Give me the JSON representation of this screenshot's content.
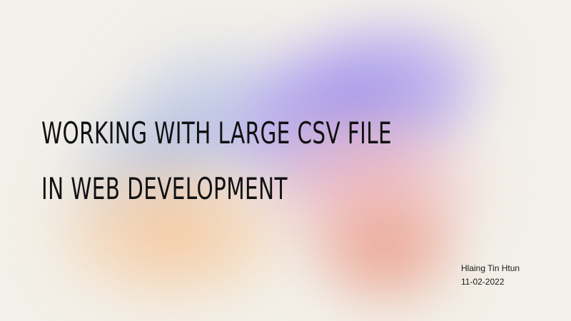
{
  "slide": {
    "title_line_1": "WORKING WITH LARGE CSV FILE",
    "title_line_2": "IN WEB DEVELOPMENT",
    "author": "Hlaing Tin Htun",
    "date": "11-02-2022"
  },
  "colors": {
    "background": "#f3f0e9",
    "text": "#111111",
    "gradient_violet": "#9b8ceb",
    "gradient_pink": "#f0afb9",
    "gradient_orange": "#f6c496",
    "gradient_coral": "#e89682"
  }
}
